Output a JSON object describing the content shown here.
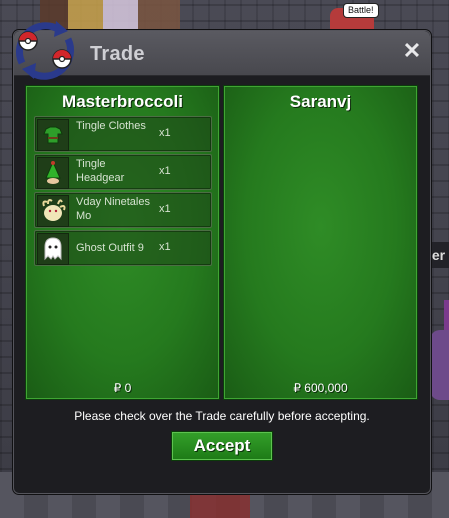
{
  "background": {
    "speech_bubble": "Battle!",
    "edge_tab_glyph": "er"
  },
  "window": {
    "title": "Trade",
    "close_glyph": "✕",
    "logo_icon": "trade-arrows-pokeball-icon"
  },
  "left_panel": {
    "player_name": "Masterbroccoli",
    "items": [
      {
        "name": "Tingle Clothes",
        "qty": "x1",
        "icon": "tingle-clothes-icon"
      },
      {
        "name": "Tingle Headgear",
        "qty": "x1",
        "icon": "tingle-headgear-icon"
      },
      {
        "name": "Vday Ninetales Mo",
        "qty": "x1",
        "icon": "vday-ninetales-icon"
      },
      {
        "name": "Ghost Outfit 9",
        "qty": "x1",
        "icon": "ghost-outfit-icon"
      }
    ],
    "money": "₽ 0"
  },
  "right_panel": {
    "player_name": "Saranvj",
    "items": [],
    "money": "₽ 600,000"
  },
  "notice": "Please check over the Trade carefully before accepting.",
  "accept_label": "Accept",
  "colors": {
    "panel_green": "#257a1e",
    "accept_green": "#2a8f22",
    "window_dark": "#1d1d21"
  }
}
